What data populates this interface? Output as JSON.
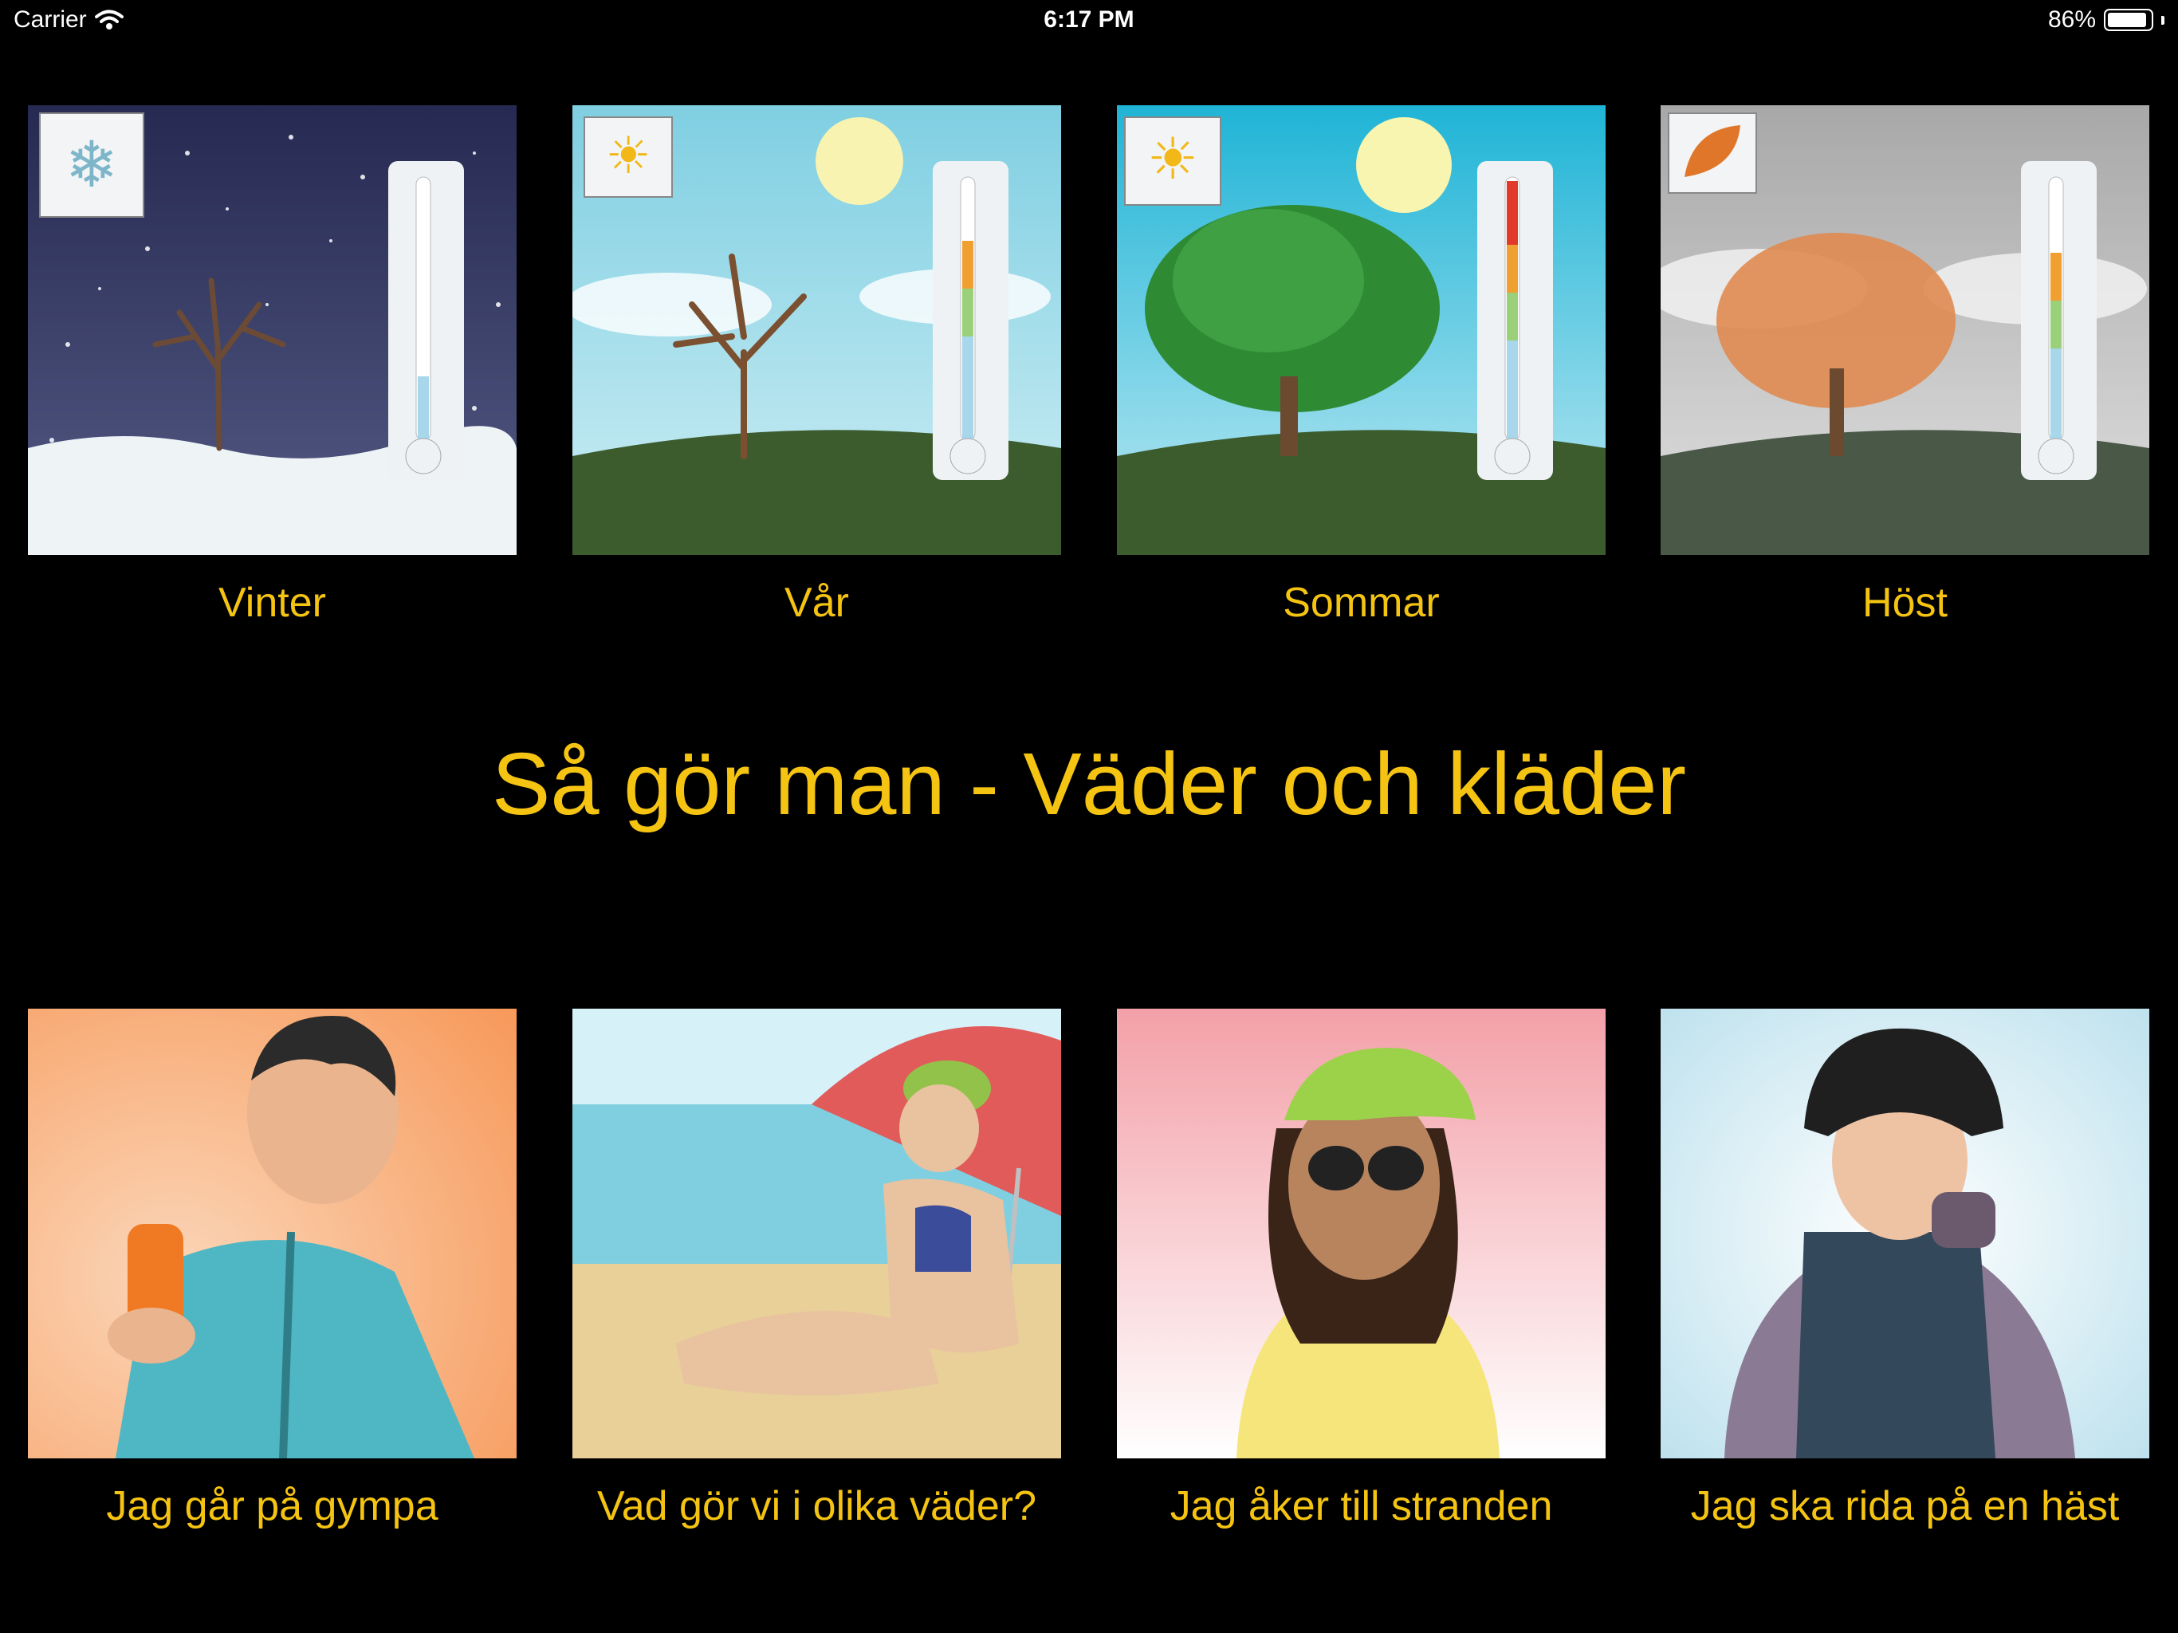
{
  "status_bar": {
    "carrier": "Carrier",
    "time": "6:17 PM",
    "battery": "86%",
    "battery_level": 0.86
  },
  "title": "Så gör man - Väder och kläder",
  "seasons": [
    {
      "label": "Vinter",
      "icon": "snowflake-icon"
    },
    {
      "label": "Vår",
      "icon": "sun-cloud-icon"
    },
    {
      "label": "Sommar",
      "icon": "sun-icon"
    },
    {
      "label": "Höst",
      "icon": "leaf-icon"
    }
  ],
  "activities": [
    {
      "label": "Jag går på gympa"
    },
    {
      "label": "Vad gör vi i olika väder?"
    },
    {
      "label": "Jag åker till stranden"
    },
    {
      "label": "Jag ska rida på en häst"
    }
  ],
  "colors": {
    "accent": "#f5c412",
    "background": "#000000"
  }
}
